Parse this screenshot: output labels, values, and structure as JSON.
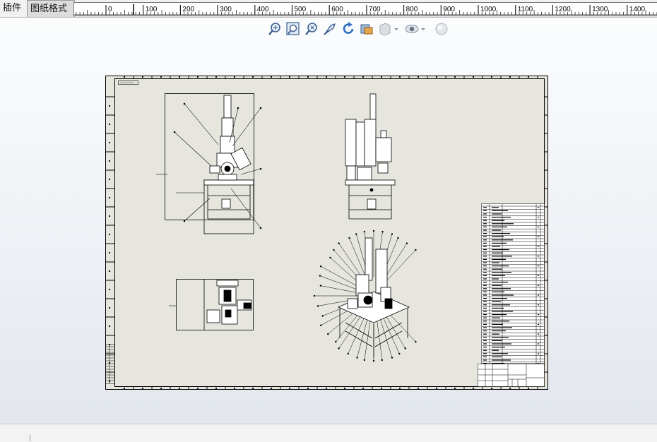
{
  "tabs": [
    {
      "label": "插件",
      "active": false
    },
    {
      "label": "图纸格式",
      "active": true
    }
  ],
  "ruler": {
    "labels": [
      "0",
      "100",
      "200",
      "300",
      "400",
      "500",
      "600",
      "700",
      "800",
      "900",
      "1000",
      "1100",
      "1200",
      "1300",
      "1400"
    ]
  },
  "heads_up_toolbar": [
    {
      "icon": "zoom-to-fit-icon"
    },
    {
      "icon": "zoom-to-area-icon"
    },
    {
      "icon": "zoom-in-out-icon"
    },
    {
      "icon": "pan-icon"
    },
    {
      "icon": "rotate-icon"
    },
    {
      "icon": "section-view-icon"
    },
    {
      "icon": "display-style-icon",
      "dropdown": true
    },
    {
      "icon": "hide-show-items-icon",
      "dropdown": true
    },
    {
      "icon": "apply-scene-icon"
    }
  ],
  "colors": {
    "sheet_background": "#e5e5dd",
    "line": "#000000",
    "viewport_top": "#fbfcfd",
    "viewport_bottom": "#e3e7ee"
  }
}
